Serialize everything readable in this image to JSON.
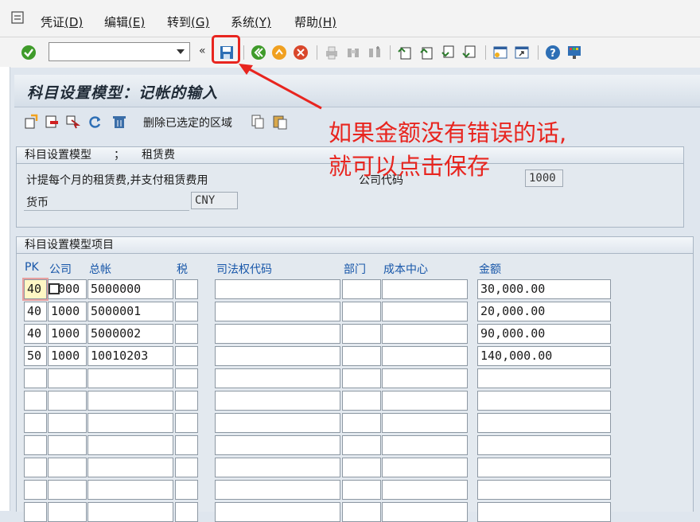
{
  "menu": {
    "items": [
      {
        "label": "凭证",
        "hotkey": "(D)"
      },
      {
        "label": "编辑",
        "hotkey": "(E)"
      },
      {
        "label": "转到",
        "hotkey": "(G)"
      },
      {
        "label": "系统",
        "hotkey": "(Y)"
      },
      {
        "label": "帮助",
        "hotkey": "(H)"
      }
    ]
  },
  "toolbar": {
    "command_value": "",
    "chevron": "«",
    "icons": [
      "check-icon",
      "save-icon",
      "back-icon",
      "exit-icon",
      "cancel-icon",
      "print-icon",
      "find-icon",
      "find-next-icon",
      "first-page-icon",
      "prev-page-icon",
      "next-page-icon",
      "last-page-icon",
      "new-session-icon",
      "shortcut-icon",
      "help-icon",
      "layout-icon"
    ]
  },
  "title": "科目设置模型：记帐的输入",
  "app_toolbar": {
    "delete_label": "删除已选定的区域",
    "icons": [
      "insert-icon",
      "delete-row-icon",
      "select-icon",
      "refresh-icon",
      "trash-icon",
      "copy-icon",
      "paste-icon"
    ]
  },
  "header_group": {
    "title": "科目设置模型　　；　　租赁费",
    "description": "计提每个月的租赁费,并支付租赁费用",
    "company_code_label": "公司代码",
    "company_code_value": "1000",
    "currency_label": "货币",
    "currency_value": "CNY"
  },
  "items_group": {
    "title": "科目设置模型项目",
    "columns": [
      "PK",
      "公司",
      "总帐",
      "税",
      "司法权代码",
      "部门",
      "成本中心",
      "金额"
    ],
    "rows": [
      {
        "pk": "40",
        "company": "1000",
        "gl": "5000000",
        "tax": "",
        "jur": "",
        "dept": "",
        "cc": "",
        "amount": "30,000.00"
      },
      {
        "pk": "40",
        "company": "1000",
        "gl": "5000001",
        "tax": "",
        "jur": "",
        "dept": "",
        "cc": "",
        "amount": "20,000.00"
      },
      {
        "pk": "40",
        "company": "1000",
        "gl": "5000002",
        "tax": "",
        "jur": "",
        "dept": "",
        "cc": "",
        "amount": "90,000.00"
      },
      {
        "pk": "50",
        "company": "1000",
        "gl": "10010203",
        "tax": "",
        "jur": "",
        "dept": "",
        "cc": "",
        "amount": "140,000.00"
      }
    ],
    "empty_row_count": 7
  },
  "annotation": {
    "line1": "如果金额没有错误的话,",
    "line2": "就可以点击保存",
    "color": "#e8251f"
  }
}
